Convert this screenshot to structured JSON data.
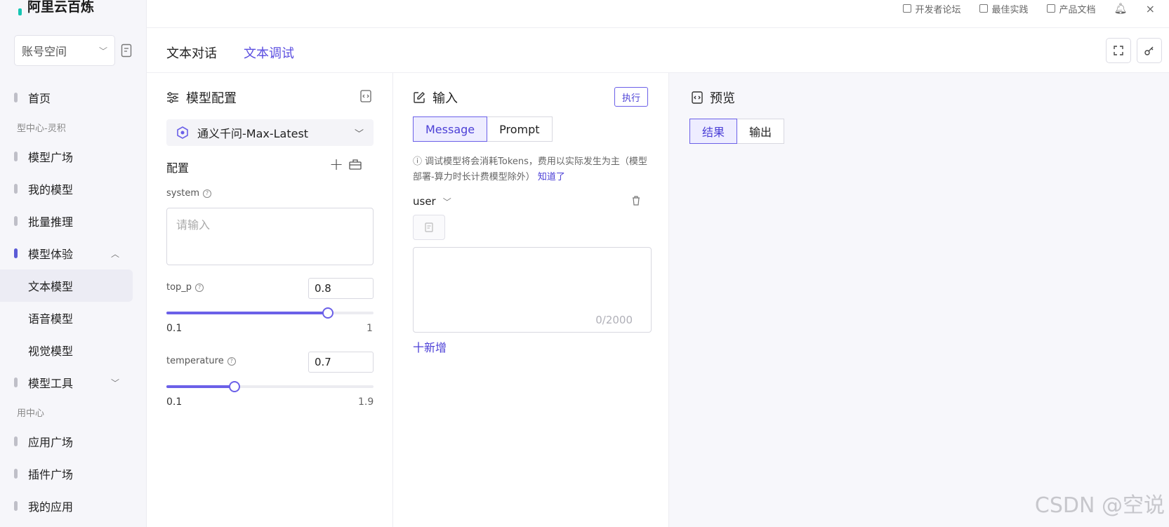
{
  "brand": {
    "title": "阿里云百炼"
  },
  "sidebar": {
    "workspace": "账号空间",
    "items": [
      {
        "label": "首页",
        "type": "item"
      },
      {
        "label": "型中心-灵积",
        "type": "section"
      },
      {
        "label": "模型广场",
        "type": "item"
      },
      {
        "label": "我的模型",
        "type": "item"
      },
      {
        "label": "批量推理",
        "type": "item"
      },
      {
        "label": "模型体验",
        "type": "item"
      },
      {
        "label": "文本模型",
        "type": "sub"
      },
      {
        "label": "语音模型",
        "type": "sub"
      },
      {
        "label": "视觉模型",
        "type": "sub"
      },
      {
        "label": "模型工具",
        "type": "item"
      },
      {
        "label": "用中心",
        "type": "section"
      },
      {
        "label": "应用广场",
        "type": "item"
      },
      {
        "label": "插件广场",
        "type": "item"
      },
      {
        "label": "我的应用",
        "type": "item"
      }
    ]
  },
  "topbar": {
    "links": [
      "开发者论坛",
      "最佳实践",
      "产品文档"
    ]
  },
  "tabs": [
    {
      "label": "文本对话",
      "active": false
    },
    {
      "label": "文本调试",
      "active": true
    }
  ],
  "config": {
    "title": "模型配置",
    "model": "通义千问-Max-Latest",
    "section": "配置",
    "system_label": "system",
    "system_placeholder": "请输入",
    "top_p_label": "top_p",
    "top_p_value": "0.8",
    "top_p_min": "0.1",
    "top_p_max": "1",
    "top_p_fraction": 0.78,
    "temperature_label": "temperature",
    "temperature_value": "0.7",
    "temperature_min": "0.1",
    "temperature_max": "1.9",
    "temperature_fraction": 0.33
  },
  "input": {
    "title": "输入",
    "run": "执行",
    "seg": [
      "Message",
      "Prompt"
    ],
    "notice": "调试模型将会消耗Tokens，费用以实际发生为主（模型部署-算力时长计费模型除外）",
    "notice_link": "知道了",
    "role": "user",
    "count": "0/2000",
    "add": "十新增"
  },
  "preview": {
    "title": "预览",
    "seg": [
      "结果",
      "输出"
    ]
  },
  "watermark": "CSDN @空说",
  "colors": {
    "accent": "#5b4ee0",
    "teal": "#16c6b3"
  }
}
